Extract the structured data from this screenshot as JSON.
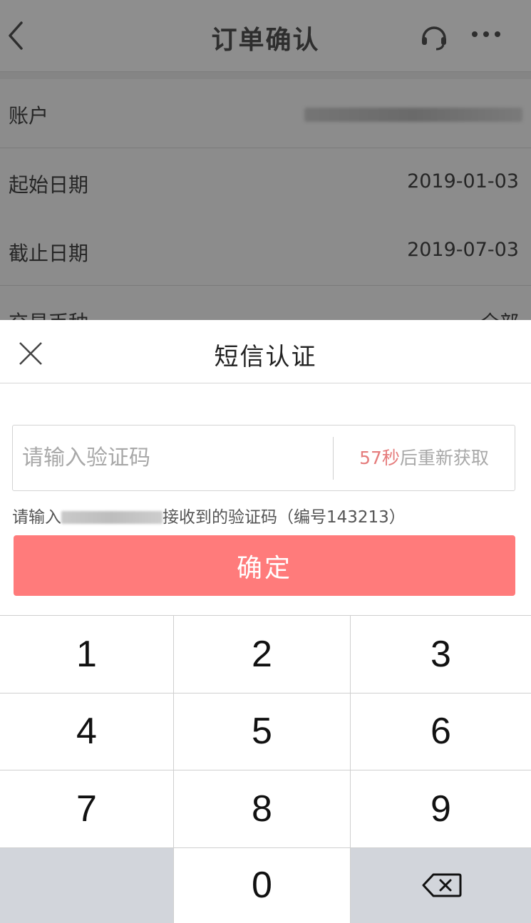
{
  "nav": {
    "title": "订单确认",
    "back_icon": "chevron-left-icon",
    "service_icon": "headset-icon",
    "more_icon": "more-dots-icon"
  },
  "order_rows": [
    {
      "label": "账户",
      "value": ""
    },
    {
      "label": "起始日期",
      "value": "2019-01-03"
    },
    {
      "label": "截止日期",
      "value": "2019-07-03"
    },
    {
      "label": "交易币种",
      "value": "全部"
    }
  ],
  "sms_sheet": {
    "title": "短信认证",
    "close_icon": "close-icon",
    "code_placeholder": "请输入验证码",
    "resend_seconds": "57秒",
    "resend_suffix": "后重新获取",
    "hint_prefix": "请输入",
    "hint_suffix": "接收到的验证码（编号143213）",
    "confirm_label": "确定"
  },
  "keypad": {
    "keys": [
      "1",
      "2",
      "3",
      "4",
      "5",
      "6",
      "7",
      "8",
      "9",
      "",
      "0",
      ""
    ],
    "delete_icon": "backspace-icon"
  },
  "colors": {
    "accent_button": "#ff7b7b",
    "countdown": "#e57c7c",
    "overlay": "#8c8c8c"
  }
}
